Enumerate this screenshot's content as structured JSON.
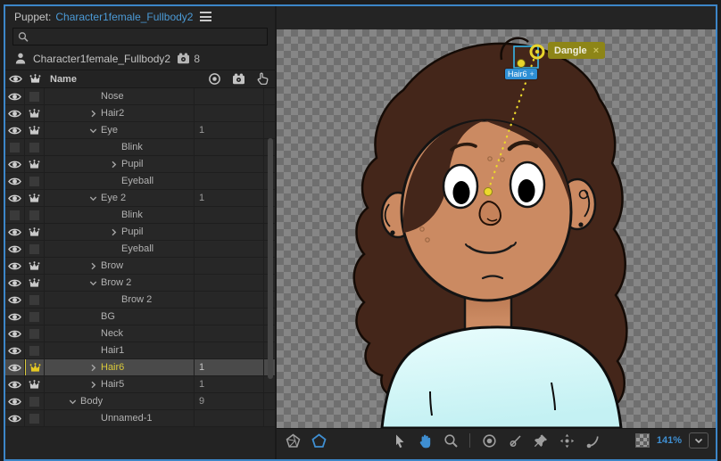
{
  "left_panel": {
    "title": {
      "prefix": "Puppet:",
      "name": "Character1female_Fullbody2"
    },
    "search": {
      "value": "",
      "placeholder": ""
    },
    "root": {
      "name": "Character1female_Fullbody2",
      "behavior_count": "8"
    },
    "header": {
      "name_label": "Name"
    },
    "rows": [
      {
        "name": "Nose",
        "level": 2,
        "arrow": "",
        "eye": true,
        "crown": false,
        "value": "",
        "selected": false
      },
      {
        "name": "Hair2",
        "level": 2,
        "arrow": "collapsed",
        "eye": true,
        "crown": true,
        "value": "",
        "selected": false
      },
      {
        "name": "Eye",
        "level": 2,
        "arrow": "expanded",
        "eye": true,
        "crown": true,
        "value": "1",
        "selected": false
      },
      {
        "name": "Blink",
        "level": 3,
        "arrow": "",
        "eye": false,
        "crown": false,
        "value": "",
        "selected": false
      },
      {
        "name": "Pupil",
        "level": 3,
        "arrow": "collapsed",
        "eye": true,
        "crown": true,
        "value": "",
        "selected": false
      },
      {
        "name": "Eyeball",
        "level": 3,
        "arrow": "",
        "eye": true,
        "crown": false,
        "value": "",
        "selected": false
      },
      {
        "name": "Eye 2",
        "level": 2,
        "arrow": "expanded",
        "eye": true,
        "crown": true,
        "value": "1",
        "selected": false
      },
      {
        "name": "Blink",
        "level": 3,
        "arrow": "",
        "eye": false,
        "crown": false,
        "value": "",
        "selected": false
      },
      {
        "name": "Pupil",
        "level": 3,
        "arrow": "collapsed",
        "eye": true,
        "crown": true,
        "value": "",
        "selected": false
      },
      {
        "name": "Eyeball",
        "level": 3,
        "arrow": "",
        "eye": true,
        "crown": false,
        "value": "",
        "selected": false
      },
      {
        "name": "Brow",
        "level": 2,
        "arrow": "collapsed",
        "eye": true,
        "crown": true,
        "value": "",
        "selected": false
      },
      {
        "name": "Brow 2",
        "level": 2,
        "arrow": "expanded",
        "eye": true,
        "crown": true,
        "value": "",
        "selected": false
      },
      {
        "name": "Brow 2",
        "level": 3,
        "arrow": "",
        "eye": true,
        "crown": false,
        "value": "",
        "selected": false
      },
      {
        "name": "BG",
        "level": 2,
        "arrow": "",
        "eye": true,
        "crown": false,
        "value": "",
        "selected": false
      },
      {
        "name": "Neck",
        "level": 2,
        "arrow": "",
        "eye": true,
        "crown": false,
        "value": "",
        "selected": false
      },
      {
        "name": "Hair1",
        "level": 2,
        "arrow": "",
        "eye": true,
        "crown": false,
        "value": "",
        "selected": false
      },
      {
        "name": "Hair6",
        "level": 2,
        "arrow": "collapsed",
        "eye": true,
        "crown": true,
        "crown_color": "#e5c822",
        "value": "1",
        "selected": true
      },
      {
        "name": "Hair5",
        "level": 2,
        "arrow": "collapsed",
        "eye": true,
        "crown": true,
        "value": "1",
        "selected": false
      },
      {
        "name": "Body",
        "level": 1,
        "arrow": "expanded",
        "eye": true,
        "crown": false,
        "value": "9",
        "selected": false
      },
      {
        "name": "Unnamed-1",
        "level": 2,
        "arrow": "",
        "eye": true,
        "crown": false,
        "value": "",
        "selected": false
      }
    ]
  },
  "canvas": {
    "tag": {
      "label": "Dangle",
      "close_label": "×"
    },
    "handle_label": "Hair6",
    "zoom": {
      "level": "141%"
    }
  },
  "colors": {
    "focus_border": "#3c86c8",
    "accent_blue": "#3f8fd2",
    "selection_yellow": "#d9c93a",
    "tag_olive": "#8d8517",
    "handle_yellow": "#ecd92c",
    "selection_cyan": "#35b5ea",
    "chip_blue": "#2e8fd5",
    "hair_brown": "#44261a",
    "skin": "#cb8a62",
    "shirt_cyan": "#daf8f8"
  }
}
